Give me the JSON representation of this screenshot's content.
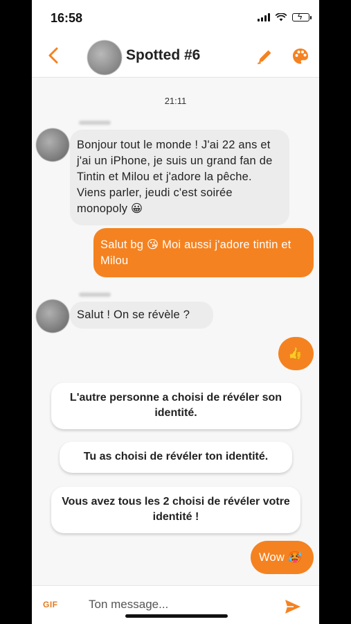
{
  "status_bar": {
    "time": "16:58"
  },
  "header": {
    "title": "Spotted #6"
  },
  "chat": {
    "timestamp": "21:11",
    "messages": [
      {
        "from": "other",
        "text": "Bonjour tout le monde ! J'ai 22 ans et j'ai un iPhone, je suis un grand fan de Tintin et Milou et j'adore la pêche. Viens parler, jeudi c'est soirée monopoly 😀"
      },
      {
        "from": "me",
        "text": "Salut bg 😘 Moi aussi j'adore tintin et Milou"
      },
      {
        "from": "other",
        "text": "Salut ! On se révèle ?"
      },
      {
        "from": "me",
        "text": "👍"
      }
    ],
    "system_messages": [
      "L'autre personne a choisi de révéler son identité.",
      "Tu as choisi de révéler ton identité.",
      "Vous avez tous les 2 choisi de révéler votre identité !"
    ],
    "last_message": {
      "from": "me",
      "text": "Wow 🥵"
    }
  },
  "input_bar": {
    "gif_label": "GIF",
    "placeholder": "Ton message..."
  },
  "colors": {
    "accent": "#f58220",
    "incoming_bubble": "#ececec",
    "background": "#f7f7f7"
  },
  "icons": [
    "back-chevron-icon",
    "pencil-icon",
    "palette-icon",
    "send-icon",
    "signal-icon",
    "wifi-icon",
    "battery-icon"
  ]
}
